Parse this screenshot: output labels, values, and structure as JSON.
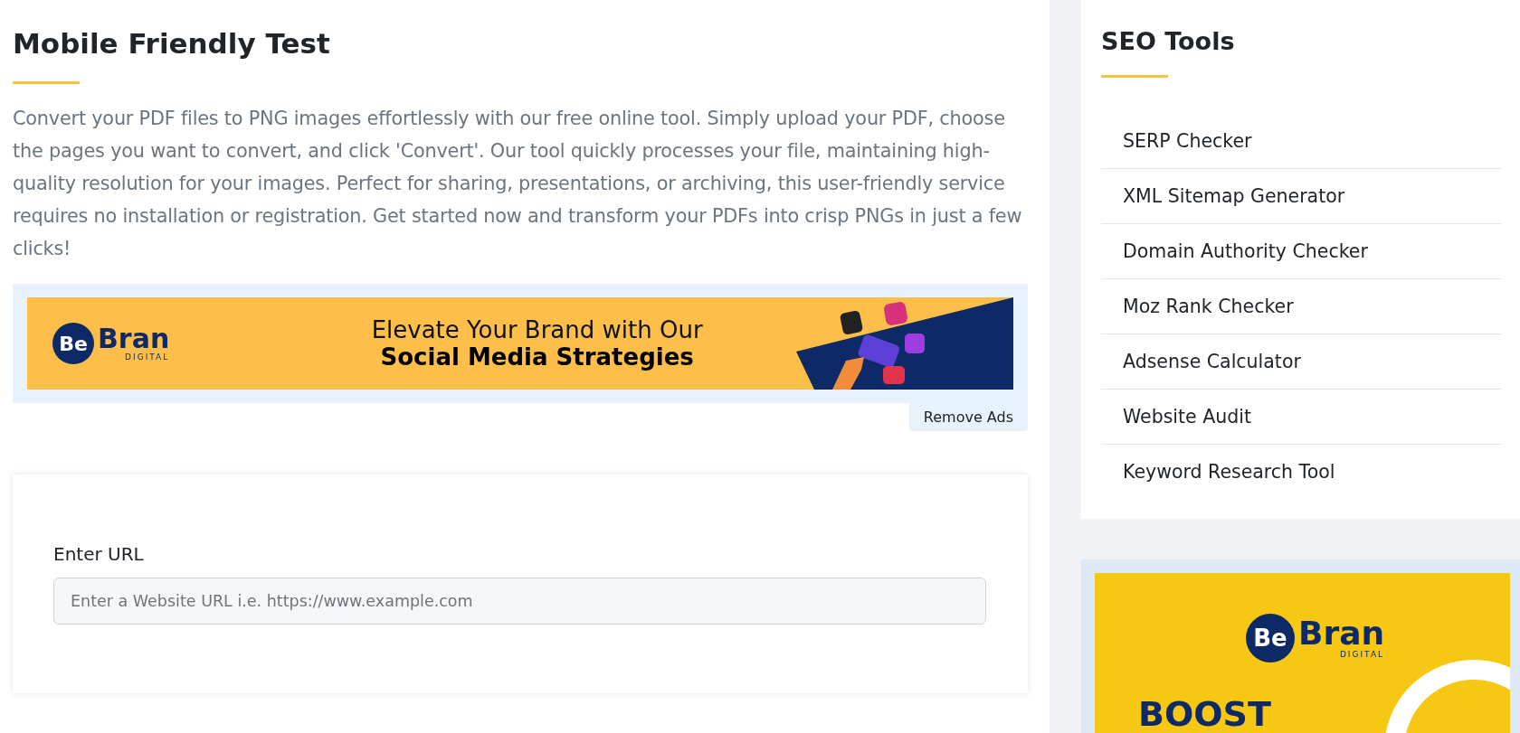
{
  "main": {
    "title": "Mobile Friendly Test",
    "description": "Convert your PDF files to PNG images effortlessly with our free online tool. Simply upload your PDF, choose the pages you want to convert, and click 'Convert'. Our tool quickly processes your file, maintaining high-quality resolution for your images. Perfect for sharing, presentations, or archiving, this user-friendly service requires no installation or registration. Get started now and transform your PDFs into crisp PNGs in just a few clicks!",
    "banner_ad": {
      "logo": {
        "mark": "Be",
        "name": "Bran",
        "tagline": "DIGITAL"
      },
      "headline": "Elevate Your Brand with Our",
      "subheadline": "Social Media Strategies"
    },
    "remove_ads": "Remove Ads",
    "form": {
      "label": "Enter URL",
      "placeholder": "Enter a Website URL i.e. https://www.example.com"
    }
  },
  "sidebar": {
    "title": "SEO Tools",
    "items": [
      {
        "label": "SERP Checker"
      },
      {
        "label": "XML Sitemap Generator"
      },
      {
        "label": "Domain Authority Checker"
      },
      {
        "label": "Moz Rank Checker"
      },
      {
        "label": "Adsense Calculator"
      },
      {
        "label": "Website Audit"
      },
      {
        "label": "Keyword Research Tool"
      }
    ],
    "ad": {
      "logo": {
        "mark": "Be",
        "name": "Bran",
        "tagline": "DIGITAL"
      },
      "headline": "BOOST"
    }
  }
}
